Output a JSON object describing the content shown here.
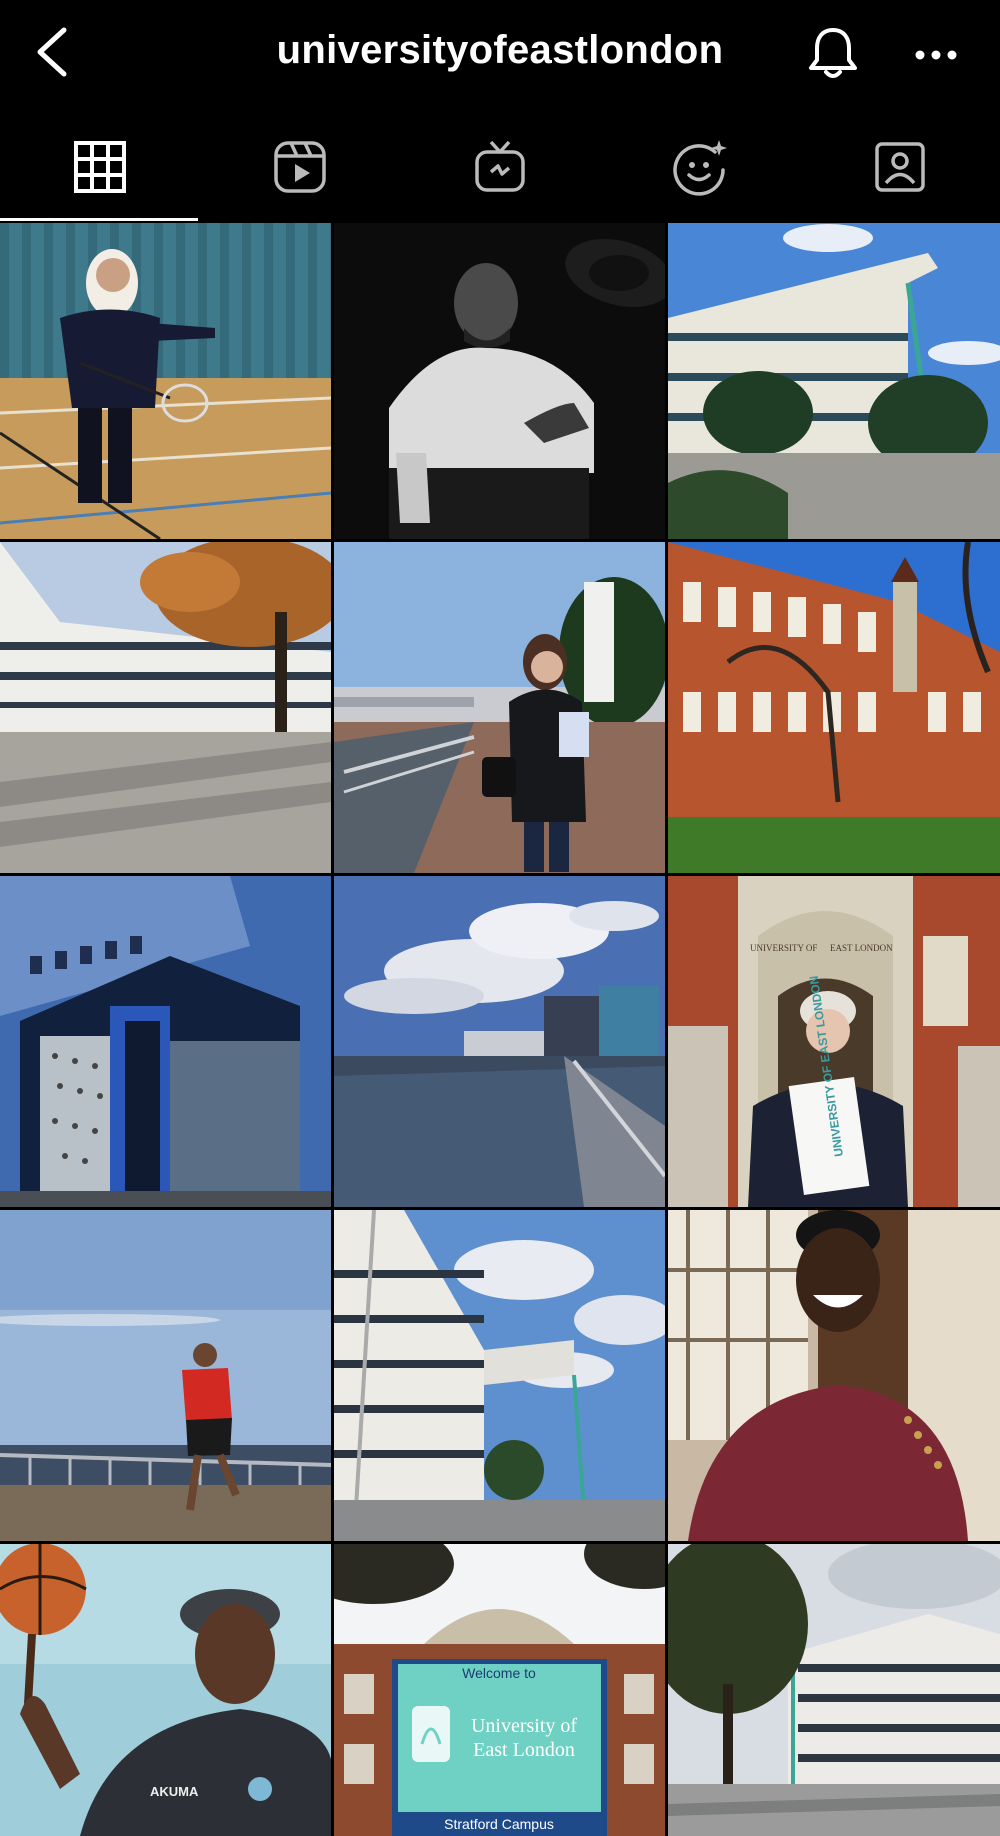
{
  "header": {
    "username": "universityofeastlondon",
    "back_icon": "chevron-left-icon",
    "bell_icon": "bell-icon",
    "more_icon": "more-dots-icon"
  },
  "tabs": [
    {
      "name": "grid-tab",
      "icon": "grid-icon",
      "active": true
    },
    {
      "name": "reels-tab",
      "icon": "reels-icon",
      "active": false
    },
    {
      "name": "igtv-tab",
      "icon": "igtv-icon",
      "active": false
    },
    {
      "name": "effects-tab",
      "icon": "effects-icon",
      "active": false
    },
    {
      "name": "tagged-tab",
      "icon": "tagged-person-icon",
      "active": false
    }
  ],
  "posts": {
    "welcome_sign": {
      "line1": "Welcome to",
      "line2": "University of",
      "line3": "East London",
      "line4": "Stratford Campus"
    },
    "certificate_text": "UNIVERSITY OF EAST LONDON",
    "arch_left": "UNIVERSITY OF",
    "arch_right": "EAST LONDON",
    "shirt_text": "AKUMA"
  },
  "colors": {
    "background": "#000000",
    "text": "#ffffff",
    "brand_teal": "#5fc6b5"
  }
}
